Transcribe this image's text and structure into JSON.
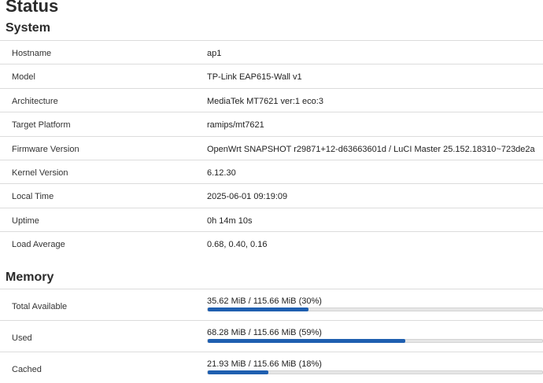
{
  "page_title": "Status",
  "system": {
    "title": "System",
    "rows": [
      {
        "label": "Hostname",
        "value": "ap1"
      },
      {
        "label": "Model",
        "value": "TP-Link EAP615-Wall v1"
      },
      {
        "label": "Architecture",
        "value": "MediaTek MT7621 ver:1 eco:3"
      },
      {
        "label": "Target Platform",
        "value": "ramips/mt7621"
      },
      {
        "label": "Firmware Version",
        "value": "OpenWrt SNAPSHOT r29871+12-d63663601d / LuCI Master 25.152.18310~723de2a"
      },
      {
        "label": "Kernel Version",
        "value": "6.12.30"
      },
      {
        "label": "Local Time",
        "value": "2025-06-01 09:19:09"
      },
      {
        "label": "Uptime",
        "value": "0h 14m 10s"
      },
      {
        "label": "Load Average",
        "value": "0.68, 0.40, 0.16"
      }
    ]
  },
  "memory": {
    "title": "Memory",
    "bar_color": "#1f5fb0",
    "rows": [
      {
        "label": "Total Available",
        "value": "35.62 MiB / 115.66 MiB (30%)",
        "fraction": 0.3
      },
      {
        "label": "Used",
        "value": "68.28 MiB / 115.66 MiB (59%)",
        "fraction": 0.59
      },
      {
        "label": "Cached",
        "value": "21.93 MiB / 115.66 MiB (18%)",
        "fraction": 0.18
      }
    ]
  }
}
